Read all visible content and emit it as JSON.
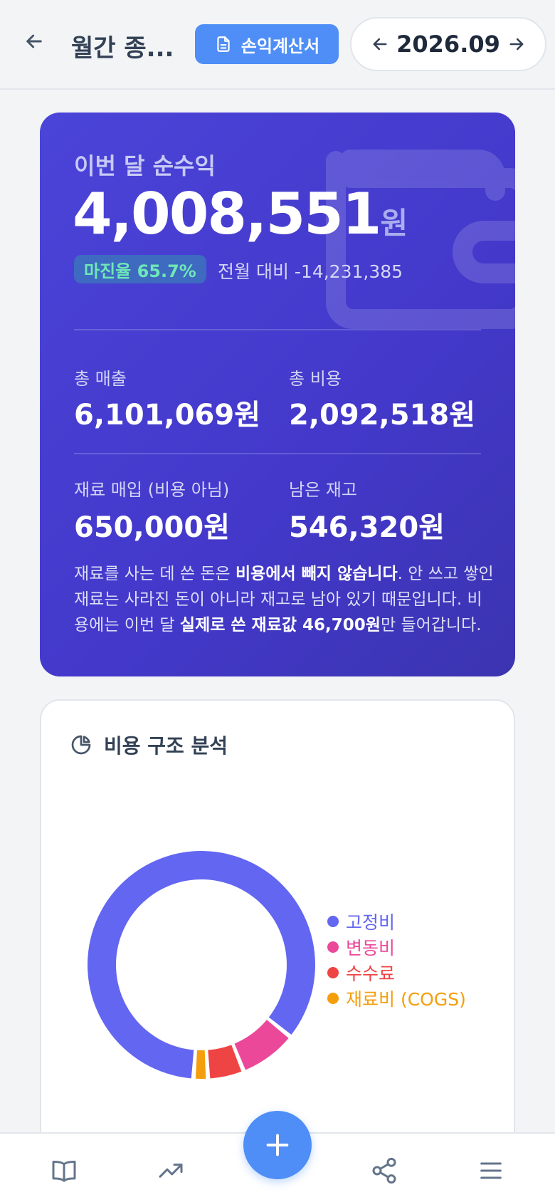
{
  "header": {
    "title": "월간 종...",
    "pl_button_label": "손익계산서",
    "month": "2026.09"
  },
  "profit_card": {
    "label": "이번 달 순수익",
    "value": "4,008,551",
    "unit": "원",
    "margin_badge": "마진율 65.7%",
    "mom_text": "전월 대비 -14,231,385",
    "stats": [
      {
        "label": "총 매출",
        "value": "6,101,069원"
      },
      {
        "label": "총 비용",
        "value": "2,092,518원"
      },
      {
        "label": "재료 매입 (비용 아님)",
        "value": "650,000원"
      },
      {
        "label": "남은 재고",
        "value": "546,320원"
      }
    ],
    "note": {
      "p1": "재료를 사는 데 쓴 돈은 ",
      "b1": "비용에서 빼지 않습니다",
      "p2": ". 안 쓰고 쌓인 재료는 사라진 돈이 아니라 재고로 남아 있기 때문입니다. 비용에는 이번 달 ",
      "b2": "실제로 쓴 재료값 46,700원",
      "p3": "만 들어갑니다."
    }
  },
  "cost_card": {
    "title": "비용 구조 분석"
  },
  "chart_data": {
    "type": "pie",
    "donut": true,
    "categories": [
      "고정비",
      "변동비",
      "수수료",
      "재료비 (COGS)"
    ],
    "values": [
      83,
      8,
      5,
      2
    ],
    "colors": [
      "#6366f1",
      "#ec4899",
      "#ef4444",
      "#f59e0b"
    ],
    "legend": "right"
  },
  "bottom_nav": {
    "items": [
      "book-icon",
      "trend-icon",
      "add-icon",
      "share-icon",
      "menu-icon"
    ]
  }
}
